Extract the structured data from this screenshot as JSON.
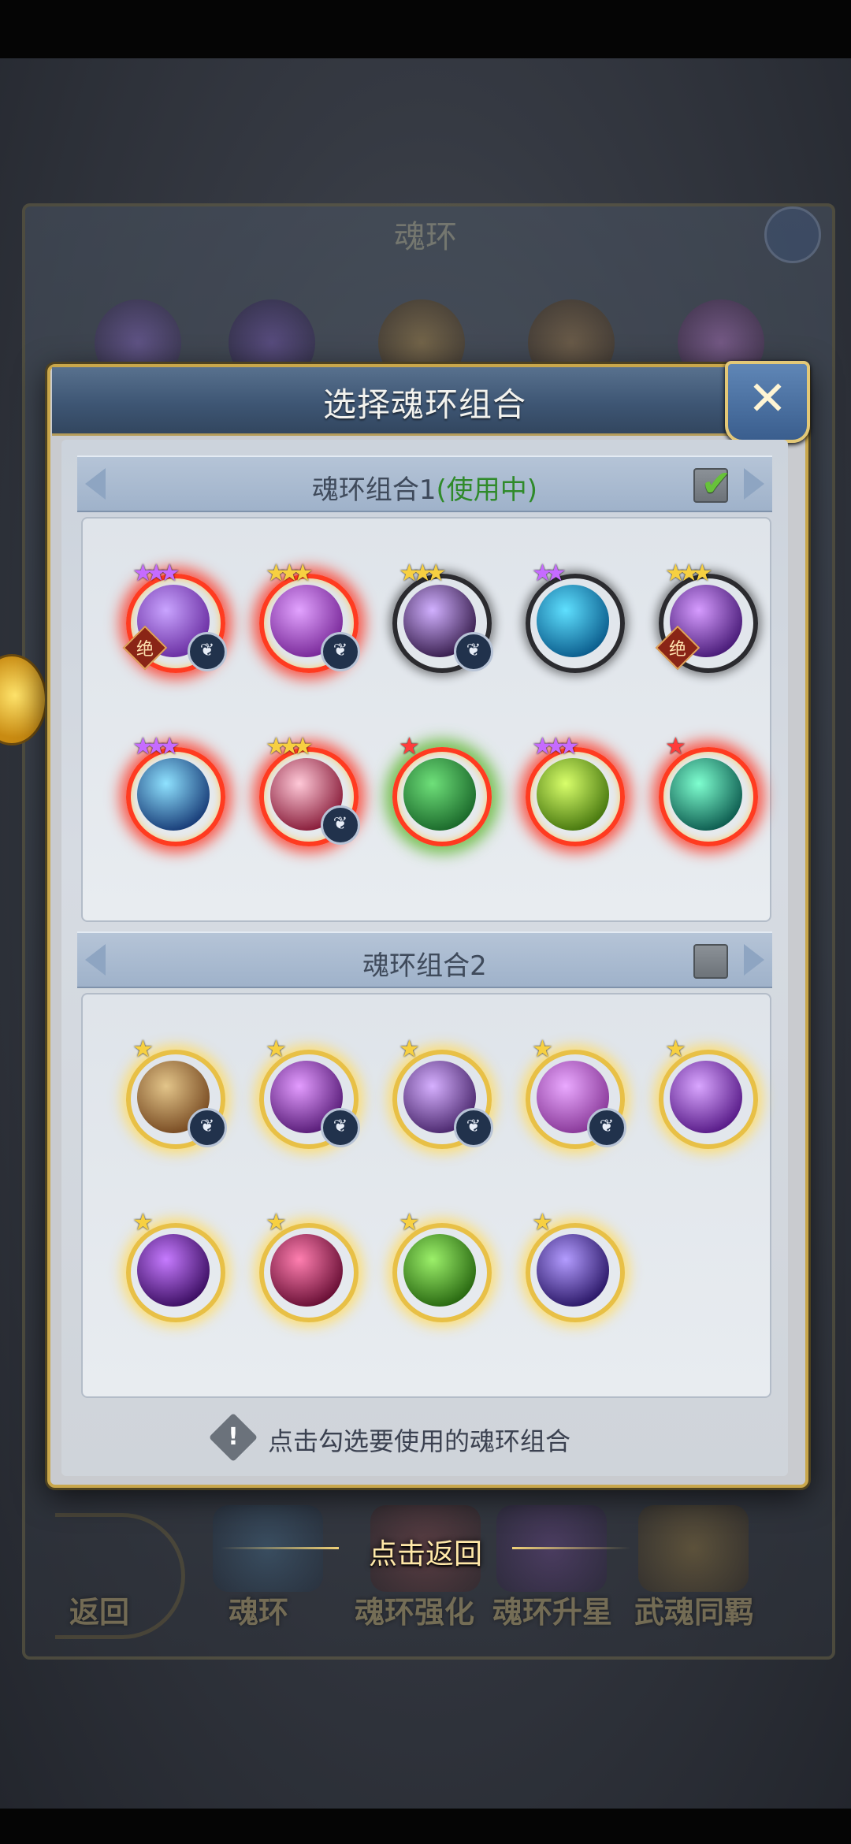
{
  "dialog": {
    "title": "选择魂环组合",
    "close_label": "✕",
    "background_title": "魂环"
  },
  "groups": [
    {
      "name": "魂环组合1",
      "status": "(使用中)",
      "checked": true,
      "check_glyph": "✔",
      "skills": [
        {
          "stars": 3,
          "star_color": "purple",
          "ring": "red",
          "badge_jue": "绝",
          "badge_wing": true,
          "icon": "tornado-skill-icon",
          "colors": [
            "#c9a4ff",
            "#6b2fa3"
          ]
        },
        {
          "stars": 3,
          "star_color": "gold",
          "ring": "red",
          "badge_jue": "",
          "badge_wing": true,
          "icon": "scale-orb-skill-icon",
          "colors": [
            "#e2a3ff",
            "#7a2a9a"
          ]
        },
        {
          "stars": 3,
          "star_color": "gold",
          "ring": "dark",
          "badge_jue": "",
          "badge_wing": true,
          "icon": "lightning-fist-skill-icon",
          "colors": [
            "#d1b0ff",
            "#3a2050"
          ]
        },
        {
          "stars": 2,
          "star_color": "purple",
          "ring": "dark",
          "badge_jue": "",
          "badge_wing": false,
          "icon": "water-dragon-skill-icon",
          "colors": [
            "#5fe0ff",
            "#0c5f8f"
          ]
        },
        {
          "stars": 3,
          "star_color": "gold",
          "ring": "dark",
          "badge_jue": "绝",
          "badge_wing": false,
          "icon": "purple-lightning-skill-icon",
          "colors": [
            "#d69cff",
            "#4b1d7a"
          ]
        },
        {
          "stars": 3,
          "star_color": "purple",
          "ring": "red",
          "badge_jue": "",
          "badge_wing": false,
          "icon": "blade-dash-skill-icon",
          "colors": [
            "#8fe2ff",
            "#1a3f7a"
          ]
        },
        {
          "stars": 3,
          "star_color": "gold",
          "ring": "red",
          "badge_jue": "",
          "badge_wing": true,
          "icon": "target-eye-skill-icon",
          "colors": [
            "#ffc9d8",
            "#8a1f3c"
          ]
        },
        {
          "stars": 1,
          "star_color": "red",
          "ring": "green",
          "badge_jue": "",
          "badge_wing": false,
          "icon": "vine-bow-skill-icon",
          "colors": [
            "#6fe07a",
            "#1c6b2c"
          ]
        },
        {
          "stars": 3,
          "star_color": "purple",
          "ring": "red",
          "badge_jue": "",
          "badge_wing": false,
          "icon": "golden-warrior-skill-icon",
          "colors": [
            "#d9ff6b",
            "#4a7a10"
          ]
        },
        {
          "stars": 1,
          "star_color": "red",
          "ring": "red",
          "badge_jue": "",
          "badge_wing": false,
          "icon": "green-wings-skill-icon",
          "colors": [
            "#7fffd0",
            "#0f5f52"
          ]
        }
      ]
    },
    {
      "name": "魂环组合2",
      "status": "",
      "checked": false,
      "check_glyph": "",
      "skills": [
        {
          "stars": 1,
          "star_color": "gold",
          "ring": "gold",
          "badge_jue": "",
          "badge_wing": true,
          "icon": "tornado-skill-icon",
          "colors": [
            "#e3c58a",
            "#7a4d24"
          ]
        },
        {
          "stars": 1,
          "star_color": "gold",
          "ring": "gold",
          "badge_jue": "",
          "badge_wing": true,
          "icon": "claw-slash-skill-icon",
          "colors": [
            "#e39cff",
            "#5a1e7a"
          ]
        },
        {
          "stars": 1,
          "star_color": "gold",
          "ring": "gold",
          "badge_jue": "",
          "badge_wing": true,
          "icon": "lightning-fist-skill-icon",
          "colors": [
            "#d6b0ff",
            "#4d2a70"
          ]
        },
        {
          "stars": 1,
          "star_color": "gold",
          "ring": "gold",
          "badge_jue": "",
          "badge_wing": true,
          "icon": "scale-orb-skill-icon",
          "colors": [
            "#eaa9ff",
            "#8a3a9a"
          ]
        },
        {
          "stars": 1,
          "star_color": "gold",
          "ring": "gold",
          "badge_jue": "",
          "badge_wing": false,
          "icon": "purple-lightning-skill-icon",
          "colors": [
            "#d9a6ff",
            "#5a1d8a"
          ]
        },
        {
          "stars": 1,
          "star_color": "gold",
          "ring": "gold",
          "badge_jue": "",
          "badge_wing": false,
          "icon": "shadow-burst-skill-icon",
          "colors": [
            "#c67bff",
            "#3e1065"
          ]
        },
        {
          "stars": 1,
          "star_color": "gold",
          "ring": "gold",
          "badge_jue": "",
          "badge_wing": false,
          "icon": "pink-slash-skill-icon",
          "colors": [
            "#ff7fb0",
            "#6a1036"
          ]
        },
        {
          "stars": 1,
          "star_color": "gold",
          "ring": "gold",
          "badge_jue": "",
          "badge_wing": false,
          "icon": "clover-skill-icon",
          "colors": [
            "#9cf06a",
            "#2a6a12"
          ]
        },
        {
          "stars": 1,
          "star_color": "gold",
          "ring": "gold",
          "badge_jue": "",
          "badge_wing": false,
          "icon": "vortex-skill-icon",
          "colors": [
            "#b39cff",
            "#2d1a6a"
          ]
        }
      ]
    }
  ],
  "footer": {
    "hint": "点击勾选要使用的魂环组合",
    "icon": "exclamation-icon",
    "icon_glyph": "!"
  },
  "back_hint": "点击返回",
  "background_nav": {
    "back": "返回",
    "items": [
      "魂环",
      "魂环强化",
      "魂环升星",
      "武魂同羁"
    ]
  }
}
